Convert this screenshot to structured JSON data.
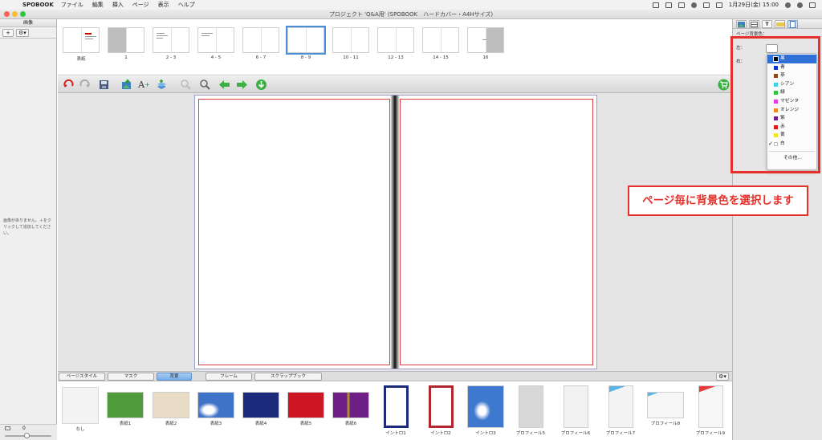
{
  "menubar": {
    "app_name": "SPOBOOK",
    "items": [
      "ファイル",
      "編集",
      "挿入",
      "ページ",
      "表示",
      "ヘルプ"
    ],
    "clock": "1月29日(金) 15:00"
  },
  "window": {
    "title": "プロジェクト 'Q&A用' (SPOBOOK　ハードカバー・A4Hサイズ)"
  },
  "left_panel": {
    "title": "画像",
    "add_label": "+",
    "gear_label": "⚙▾",
    "empty_message": "画像がありません。＋をクリックして追加してください。",
    "zoom_value": "0"
  },
  "thumbnails": [
    {
      "label": "表紙"
    },
    {
      "label": "1"
    },
    {
      "label": "2 - 3"
    },
    {
      "label": "4 - 5"
    },
    {
      "label": "6 - 7"
    },
    {
      "label": "8 - 9",
      "selected": true
    },
    {
      "label": "10 - 11"
    },
    {
      "label": "12 - 13"
    },
    {
      "label": "14 - 15"
    },
    {
      "label": "16"
    }
  ],
  "toolbar": {
    "icons": [
      "undo-icon",
      "redo-icon",
      "save-icon",
      "add-photo-icon",
      "add-text-icon",
      "add-page-icon",
      "zoom-out-icon",
      "zoom-in-icon",
      "arrow-left-icon",
      "arrow-right-icon",
      "download-icon",
      "cart-icon"
    ]
  },
  "bottom_tabs": {
    "tabs": [
      "ページスタイル",
      "マスク",
      "背景",
      "フレーム",
      "スクラップブック"
    ],
    "active": "背景",
    "gear_label": "⚙▾"
  },
  "backgrounds": [
    {
      "name": "なし",
      "color": "#f4f4f4"
    },
    {
      "name": "表紙1",
      "color": "#4f9a3a"
    },
    {
      "name": "表紙2",
      "color": "#e8dcc6"
    },
    {
      "name": "表紙3",
      "color": "#3f73c8"
    },
    {
      "name": "表紙4",
      "color": "#1c2a7c"
    },
    {
      "name": "表紙5",
      "color": "#cc1623"
    },
    {
      "name": "表紙6",
      "color": "#6d1f86"
    },
    {
      "name": "イントロ1",
      "color": "#1c2a7c"
    },
    {
      "name": "イントロ2",
      "color": "#b0272e"
    },
    {
      "name": "イントロ3",
      "color": "#3e78cf"
    },
    {
      "name": "プロフィール5",
      "color": "#d8d8d8"
    },
    {
      "name": "プロフィール6",
      "color": "#f2f2f2"
    },
    {
      "name": "プロフィール7",
      "color": "#f4f4f4"
    },
    {
      "name": "プロフィール8",
      "color": "#f6f6f6"
    },
    {
      "name": "プロフィール9",
      "color": "#f6f6f6"
    }
  ],
  "inspector": {
    "section_title": "ページ背景色：",
    "left_label": "左：",
    "right_label": "右：",
    "colors": [
      {
        "name": "黒",
        "color": "#000000",
        "highlighted": true
      },
      {
        "name": "青",
        "color": "#1432c8"
      },
      {
        "name": "茶",
        "color": "#8b4a1a"
      },
      {
        "name": "シアン",
        "color": "#3ad7e8"
      },
      {
        "name": "緑",
        "color": "#2ec83a"
      },
      {
        "name": "マゼンタ",
        "color": "#e83ae0"
      },
      {
        "name": "オレンジ",
        "color": "#f08a1e"
      },
      {
        "name": "紫",
        "color": "#6b1f8e"
      },
      {
        "name": "赤",
        "color": "#e01818"
      },
      {
        "name": "黄",
        "color": "#f2e81e"
      },
      {
        "name": "白",
        "color": "#ffffff",
        "checked": true
      }
    ],
    "other_label": "その他..."
  },
  "annotation": {
    "text": "ページ毎に背景色を選択します",
    "color": "#e6302a"
  }
}
